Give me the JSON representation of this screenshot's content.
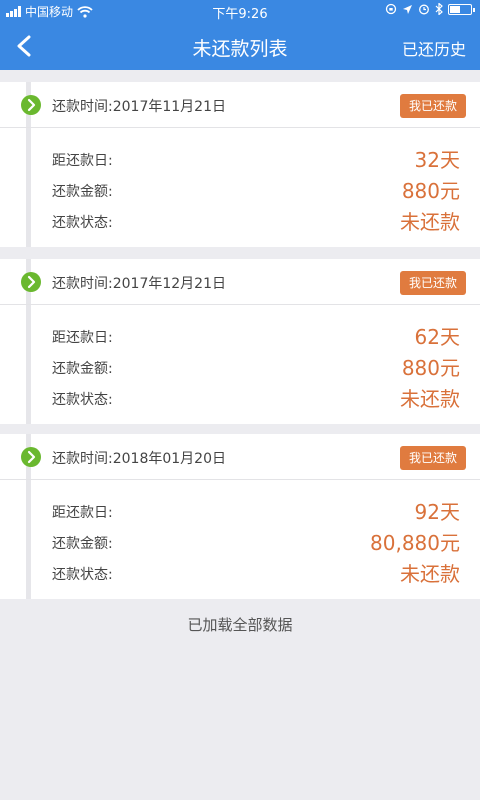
{
  "status_bar": {
    "carrier": "中国移动",
    "time": "下午9:26"
  },
  "nav": {
    "title": "未还款列表",
    "history_label": "已还历史"
  },
  "colors": {
    "nav_bg": "#3a88e2",
    "accent": "#d9713a",
    "button_bg": "#e07b3f",
    "check_green": "#6ab82f"
  },
  "labels": {
    "days_until": "距还款日:",
    "amount": "还款金额:",
    "status": "还款状态:"
  },
  "loans": [
    {
      "due_date": "还款时间:2017年11月21日",
      "action": "我已还款",
      "days": "32天",
      "amount": "880元",
      "status": "未还款"
    },
    {
      "due_date": "还款时间:2017年12月21日",
      "action": "我已还款",
      "days": "62天",
      "amount": "880元",
      "status": "未还款"
    },
    {
      "due_date": "还款时间:2018年01月20日",
      "action": "我已还款",
      "days": "92天",
      "amount": "80,880元",
      "status": "未还款"
    }
  ],
  "footer": "已加载全部数据"
}
